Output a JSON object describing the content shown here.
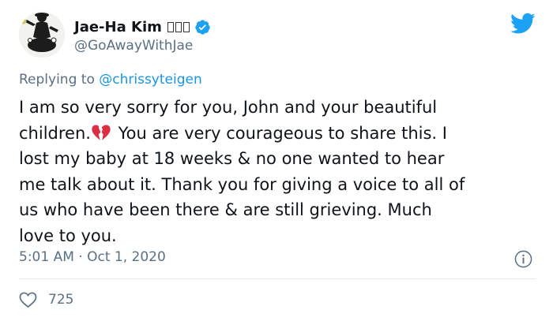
{
  "author": {
    "display_name": "Jae-Ha Kim",
    "name_glyphs": [
      "",
      "",
      ""
    ],
    "handle": "@GoAwayWithJae",
    "verified": true,
    "avatar_icon": "avatar-photo"
  },
  "reply": {
    "prefix": "Replying to ",
    "to_handle": "@chrissyteigen"
  },
  "tweet": {
    "lines": [
      "I am so very sorry for you, John and your beautiful",
      "children.",
      " You are very courageous to share this. I",
      "lost my baby at 18 weeks & no one wanted to hear",
      "me talk about it. Thank you for giving a voice to all of",
      "us who have been there & are still grieving. Much",
      "love to you."
    ],
    "emoji": "broken-heart-icon",
    "timestamp": "5:01 AM · Oct 1, 2020"
  },
  "stats": {
    "likes": "725"
  },
  "colors": {
    "brand_blue": "#1da1f2",
    "link_blue": "#1b95e0",
    "secondary_text": "#5b7083",
    "primary_text": "#0f1419",
    "broken_heart": "#dd2e44",
    "divider": "#e1e8ed"
  },
  "icons": {
    "logo": "twitter-bird-icon",
    "verified": "verified-badge-icon",
    "info": "info-icon",
    "like": "heart-outline-icon"
  }
}
